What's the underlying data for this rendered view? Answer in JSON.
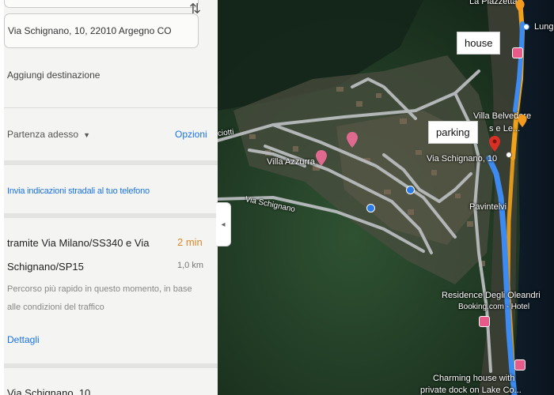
{
  "panel": {
    "destination": "Via Schignano, 10, 22010 Argegno CO",
    "add_destination": "Aggiungi destinazione",
    "departure": "Partenza adesso",
    "options": "Opzioni",
    "send_to_phone": "Invia indicazioni stradali al tuo telefono",
    "route": {
      "line1": "tramite Via Milano/SS340 e Via",
      "line2": "Schignano/SP15",
      "time": "2 min",
      "distance": "1,0 km",
      "desc_line1": "Percorso più rapido in questo momento, in base",
      "desc_line2": "alle condizioni del traffico",
      "details": "Dettagli"
    },
    "next_item": "Via Schignano, 10"
  },
  "map": {
    "labels": {
      "la_piazzetta": "La Piazzetta",
      "lungo": "Lungo",
      "villa_belvedere_1": "Villa Belvedere",
      "villa_belvedere_2": "s e Le...",
      "villa_azzurra": "Villa Azzurra",
      "via_schignano_road": "Via Schignano",
      "via_schignano_10": "Via Schignano, 10",
      "pavintelvi": "Pavintelvi",
      "residence_1": "Residence Degli Oleandri",
      "residence_2": "Booking.com - Hotel",
      "charming_1": "Charming house with",
      "charming_2": "private dock on Lake Co...",
      "ciotti": "ciotti"
    },
    "callouts": {
      "house": "house",
      "parking": "parking"
    },
    "colors": {
      "route": "#3d8bf0",
      "road_orange": "#f0a21b",
      "pin_red": "#d93025",
      "forest": "#1f3a22"
    }
  }
}
